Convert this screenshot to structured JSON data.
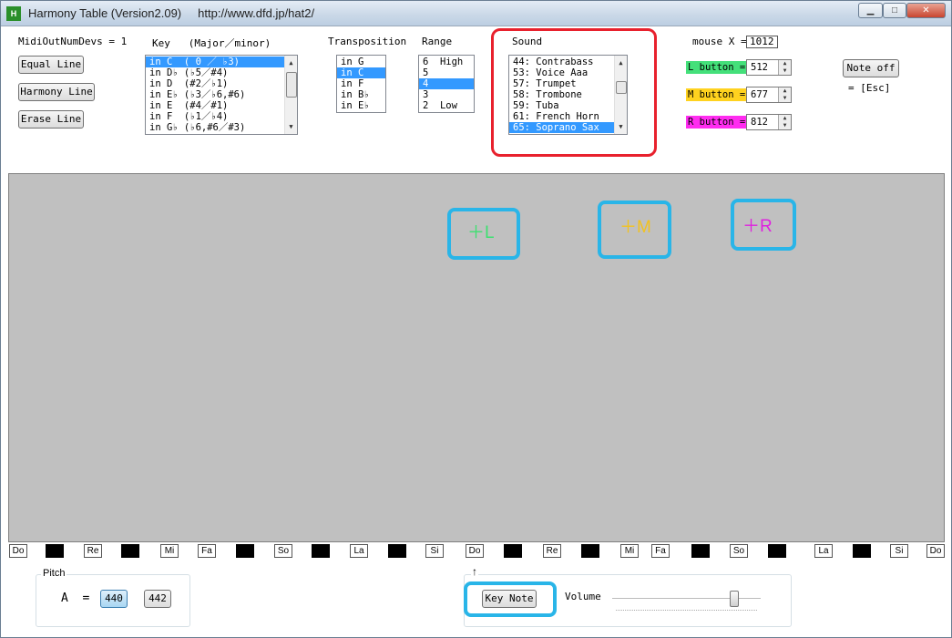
{
  "window": {
    "title": "Harmony Table (Version2.09)     http://www.dfd.jp/hat2/",
    "minimize_icon": "minimize-icon",
    "maximize_icon": "maximize-icon",
    "close_icon": "close-icon"
  },
  "midi": {
    "label": "MidiOutNumDevs = 1"
  },
  "line_buttons": {
    "equal": "Equal Line",
    "harmony": "Harmony Line",
    "erase": "Erase Line"
  },
  "key": {
    "label": "Key   (Major／minor)",
    "items": [
      "in C  ( 0 ／ ♭3)",
      "in D♭ (♭5／#4)",
      "in D  (#2／♭1)",
      "in E♭ (♭3／♭6,#6)",
      "in E  (#4／#1)",
      "in F  (♭1／♭4)",
      "in G♭ (♭6,#6／#3)"
    ],
    "selected_index": 0
  },
  "transposition": {
    "label": "Transposition",
    "items": [
      "in G",
      "in C",
      "in F",
      "in B♭",
      "in E♭"
    ],
    "selected_index": 1
  },
  "range": {
    "label": "Range",
    "items": [
      "6  High",
      "5",
      "4",
      "3",
      "2  Low"
    ],
    "selected_index": 2
  },
  "sound": {
    "label": "Sound",
    "items": [
      "44: Contrabass",
      "53: Voice Aaa",
      "57: Trumpet",
      "58: Trombone",
      "59: Tuba",
      "61: French Horn",
      "65: Soprano Sax"
    ],
    "selected_index": 6
  },
  "mouse": {
    "label": "mouse X =",
    "value": "1012"
  },
  "buttons_info": {
    "l_label": "L button =",
    "l_value": "512",
    "l_color": "#44e07a",
    "m_label": "M button =",
    "m_value": "677",
    "m_color": "#ffd21f",
    "r_label": "R button =",
    "r_value": "812",
    "r_color": "#ff2cf0"
  },
  "note_off": {
    "label": "Note off",
    "shortcut": "= [Esc]"
  },
  "markers": {
    "l": "＋L",
    "m": "＋M",
    "r": "＋R",
    "l_color": "#3de070",
    "m_color": "#f2c21f",
    "r_color": "#e020e0",
    "highlight_color": "#29b5e8"
  },
  "note_keys": [
    {
      "t": "w",
      "l": "Do"
    },
    {
      "t": "b",
      "l": ""
    },
    {
      "t": "w",
      "l": "Re"
    },
    {
      "t": "b",
      "l": ""
    },
    {
      "t": "w",
      "l": "Mi"
    },
    {
      "t": "w",
      "l": "Fa"
    },
    {
      "t": "b",
      "l": ""
    },
    {
      "t": "w",
      "l": "So"
    },
    {
      "t": "b",
      "l": ""
    },
    {
      "t": "w",
      "l": "La"
    },
    {
      "t": "b",
      "l": ""
    },
    {
      "t": "w",
      "l": "Si"
    },
    {
      "t": "w",
      "l": "Do"
    },
    {
      "t": "b",
      "l": ""
    },
    {
      "t": "w",
      "l": "Re"
    },
    {
      "t": "b",
      "l": ""
    },
    {
      "t": "w",
      "l": "Mi"
    },
    {
      "t": "w",
      "l": "Fa"
    },
    {
      "t": "b",
      "l": ""
    },
    {
      "t": "w",
      "l": "So"
    },
    {
      "t": "b",
      "l": ""
    },
    {
      "t": "w",
      "l": "La"
    },
    {
      "t": "b",
      "l": ""
    },
    {
      "t": "w",
      "l": "Si"
    },
    {
      "t": "w",
      "l": "Do"
    }
  ],
  "pitch": {
    "group_label": "Pitch",
    "a_label": "A  =",
    "b440": "440",
    "b442": "442"
  },
  "keynote": {
    "arrow": "↑",
    "button": "Key Note",
    "volume_label": "Volume",
    "volume_level": 0.82
  }
}
